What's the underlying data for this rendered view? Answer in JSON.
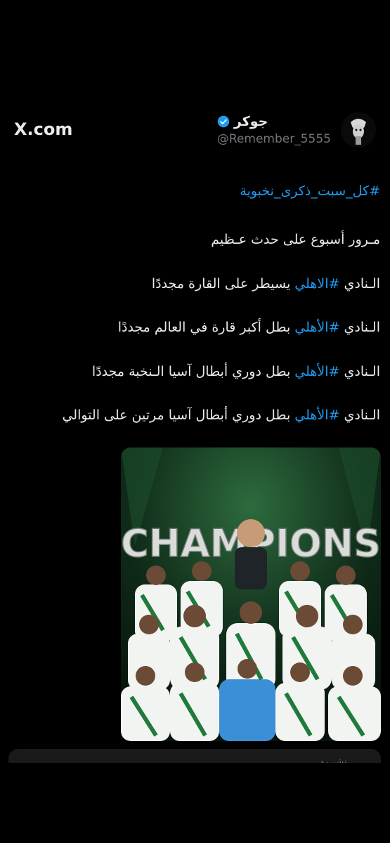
{
  "brand": {
    "label": "X.com"
  },
  "author": {
    "display_name": "جوكر",
    "handle": "@Remember_5555",
    "verified": true,
    "verified_color": "#1d9bf0"
  },
  "tweet": {
    "hashtag_line": "#كل_سبت_ذكرى_نخبوية",
    "line1": "مـرور أسبوع على حدث عـظيم",
    "line2_prefix": "الـنادي ",
    "line2_tag": "#الاهلي",
    "line2_suffix": " يسيطر على القارة مجددًا",
    "line3_prefix": "الـنادي ",
    "line3_tag": "#الأهلي",
    "line3_suffix": " بطل أكبر قارة في العالم مجددًا",
    "line4_prefix": "الـنادي ",
    "line4_tag": "#الأهلي",
    "line4_suffix": " بطل دوري أبطال آسيا الـنخبة مجددًا",
    "line5_prefix": "الـنادي ",
    "line5_tag": "#الأهلي",
    "line5_suffix": " بطل دوري أبطال آسيا مرتين على التوالي"
  },
  "media": {
    "headline": "CHAMPIONS",
    "kit_green": "#1f7a3c",
    "kit_white": "#f2f4f2",
    "keeper_blue": "#3b8fd6"
  },
  "bottom": {
    "text": "نشر رد"
  },
  "colors": {
    "link": "#1d9bf0",
    "text": "#e7e9ea",
    "muted": "#71767b"
  }
}
